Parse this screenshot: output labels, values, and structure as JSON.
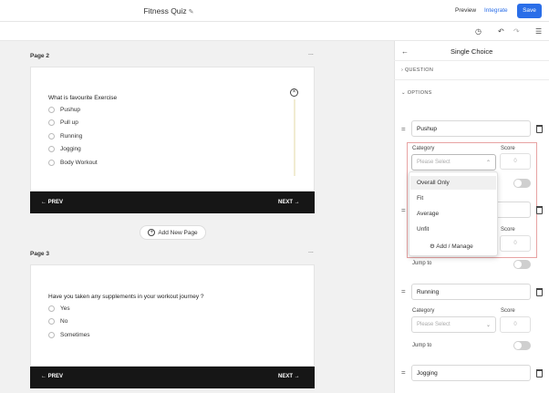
{
  "header": {
    "title": "Fitness Quiz",
    "preview": "Preview",
    "integrate": "Integrate",
    "save": "Save"
  },
  "pages": [
    {
      "label": "Page 2",
      "menu": "...",
      "question": "What is favourite Exercise",
      "options": [
        "Pushup",
        "Pull up",
        "Running",
        "Jogging",
        "Body Workout"
      ],
      "prev": "← PREV",
      "next": "NEXT →"
    },
    {
      "label": "Page 3",
      "menu": "...",
      "question": "Have you taken any supplements in your workout journey ?",
      "options": [
        "Yes",
        "No",
        "Sometimes"
      ],
      "prev": "← PREV",
      "next": "NEXT →"
    }
  ],
  "add_page": "Add New Page",
  "panel": {
    "title": "Single Choice",
    "question_section": "QUESTION",
    "options_section": "OPTIONS",
    "options": [
      {
        "value": "Pushup",
        "category_label": "Category",
        "score_label": "Score",
        "category_placeholder": "Please Select",
        "score_placeholder": "0"
      },
      {
        "value": "",
        "category_label": "",
        "score_label": "Score",
        "category_placeholder": "",
        "score_placeholder": "0",
        "jump_label": "Jump to"
      },
      {
        "value": "Running",
        "category_label": "Category",
        "score_label": "Score",
        "category_placeholder": "Please Select",
        "score_placeholder": "0",
        "jump_label": "Jump to"
      },
      {
        "value": "Jogging"
      }
    ],
    "dropdown": {
      "items": [
        "Overall Only",
        "Fit",
        "Average",
        "Unfit"
      ],
      "manage": "Add / Manage"
    }
  },
  "colors": {
    "accent": "#2a6ee8",
    "nav_bar": "#161616",
    "highlight": "#e8a3a3"
  }
}
